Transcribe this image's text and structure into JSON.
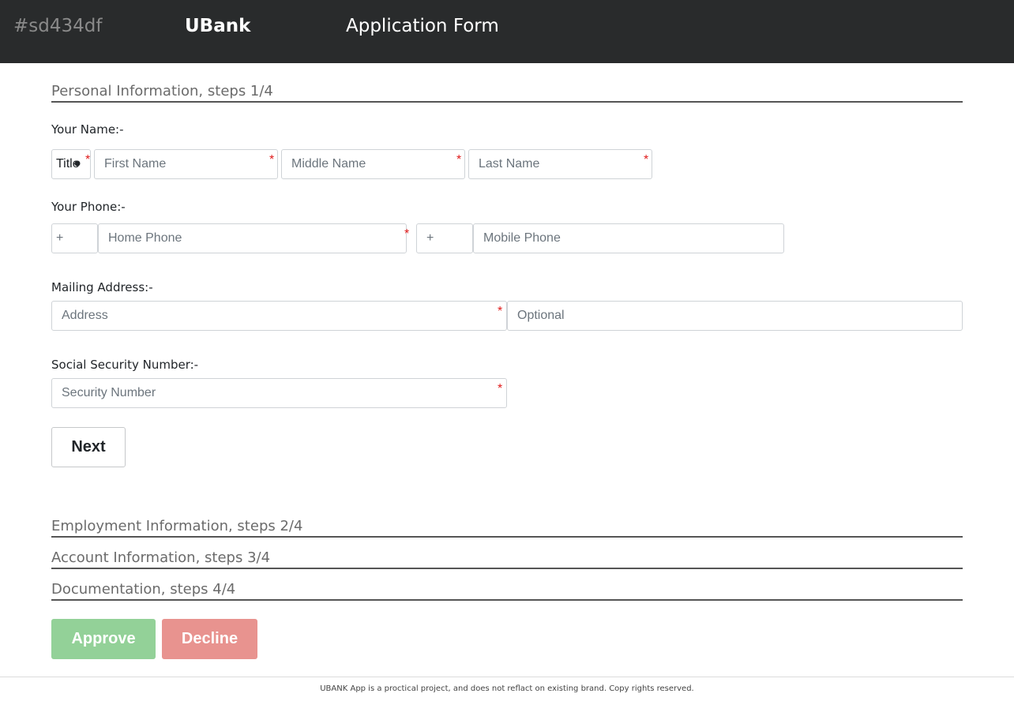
{
  "header": {
    "app_id": "#sd434df",
    "brand": "UBank",
    "title": "Application Form"
  },
  "sections": [
    {
      "label": "Personal Information, steps 1/4"
    },
    {
      "label": "Employment Information, steps 2/4"
    },
    {
      "label": "Account Information, steps 3/4"
    },
    {
      "label": "Documentation, steps 4/4"
    }
  ],
  "personal": {
    "name_label": "Your Name:-",
    "title_value": "Title",
    "first_name_placeholder": "First Name",
    "middle_name_placeholder": "Middle Name",
    "last_name_placeholder": "Last Name",
    "phone_label": "Your Phone:-",
    "home_code_value": "+",
    "home_phone_placeholder": "Home Phone",
    "mobile_code_value": "+",
    "mobile_phone_placeholder": "Mobile Phone",
    "address_label": "Mailing Address:-",
    "address_placeholder": "Address",
    "address_optional_placeholder": "Optional",
    "ssn_label": "Social Security Number:-",
    "ssn_placeholder": "Security Number",
    "required_mark": "*"
  },
  "buttons": {
    "next": "Next",
    "approve": "Approve",
    "decline": "Decline"
  },
  "footer": {
    "text": "UBANK App is a proctical project, and does not reflact on existing brand. Copy rights reserved."
  },
  "colors": {
    "topbar": "#292b2c",
    "approve": "#93d198",
    "decline": "#e8938f",
    "required": "#e01b1b"
  }
}
